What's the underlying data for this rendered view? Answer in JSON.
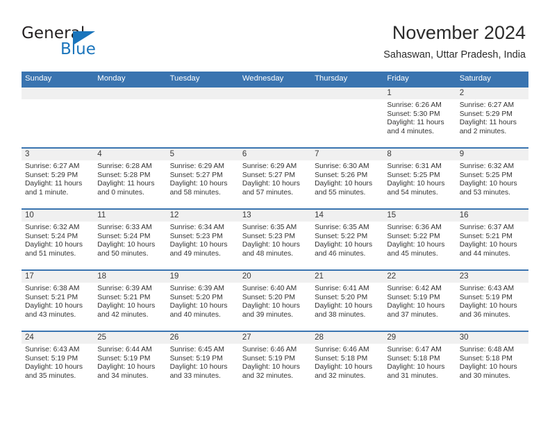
{
  "logo": {
    "word_one": "General",
    "word_two": "Blue",
    "triangle_icon": "triangle-icon",
    "accent_color": "#1b75bc"
  },
  "header": {
    "title": "November 2024",
    "subtitle": "Sahaswan, Uttar Pradesh, India"
  },
  "theme": {
    "header_blue": "#3a74b0",
    "band_gray": "#f0f0f0"
  },
  "calendar": {
    "day_names": [
      "Sunday",
      "Monday",
      "Tuesday",
      "Wednesday",
      "Thursday",
      "Friday",
      "Saturday"
    ],
    "weeks": [
      [
        {
          "day": ""
        },
        {
          "day": ""
        },
        {
          "day": ""
        },
        {
          "day": ""
        },
        {
          "day": ""
        },
        {
          "day": "1",
          "sunrise": "Sunrise: 6:26 AM",
          "sunset": "Sunset: 5:30 PM",
          "daylight": "Daylight: 11 hours and 4 minutes."
        },
        {
          "day": "2",
          "sunrise": "Sunrise: 6:27 AM",
          "sunset": "Sunset: 5:29 PM",
          "daylight": "Daylight: 11 hours and 2 minutes."
        }
      ],
      [
        {
          "day": "3",
          "sunrise": "Sunrise: 6:27 AM",
          "sunset": "Sunset: 5:29 PM",
          "daylight": "Daylight: 11 hours and 1 minute."
        },
        {
          "day": "4",
          "sunrise": "Sunrise: 6:28 AM",
          "sunset": "Sunset: 5:28 PM",
          "daylight": "Daylight: 11 hours and 0 minutes."
        },
        {
          "day": "5",
          "sunrise": "Sunrise: 6:29 AM",
          "sunset": "Sunset: 5:27 PM",
          "daylight": "Daylight: 10 hours and 58 minutes."
        },
        {
          "day": "6",
          "sunrise": "Sunrise: 6:29 AM",
          "sunset": "Sunset: 5:27 PM",
          "daylight": "Daylight: 10 hours and 57 minutes."
        },
        {
          "day": "7",
          "sunrise": "Sunrise: 6:30 AM",
          "sunset": "Sunset: 5:26 PM",
          "daylight": "Daylight: 10 hours and 55 minutes."
        },
        {
          "day": "8",
          "sunrise": "Sunrise: 6:31 AM",
          "sunset": "Sunset: 5:25 PM",
          "daylight": "Daylight: 10 hours and 54 minutes."
        },
        {
          "day": "9",
          "sunrise": "Sunrise: 6:32 AM",
          "sunset": "Sunset: 5:25 PM",
          "daylight": "Daylight: 10 hours and 53 minutes."
        }
      ],
      [
        {
          "day": "10",
          "sunrise": "Sunrise: 6:32 AM",
          "sunset": "Sunset: 5:24 PM",
          "daylight": "Daylight: 10 hours and 51 minutes."
        },
        {
          "day": "11",
          "sunrise": "Sunrise: 6:33 AM",
          "sunset": "Sunset: 5:24 PM",
          "daylight": "Daylight: 10 hours and 50 minutes."
        },
        {
          "day": "12",
          "sunrise": "Sunrise: 6:34 AM",
          "sunset": "Sunset: 5:23 PM",
          "daylight": "Daylight: 10 hours and 49 minutes."
        },
        {
          "day": "13",
          "sunrise": "Sunrise: 6:35 AM",
          "sunset": "Sunset: 5:23 PM",
          "daylight": "Daylight: 10 hours and 48 minutes."
        },
        {
          "day": "14",
          "sunrise": "Sunrise: 6:35 AM",
          "sunset": "Sunset: 5:22 PM",
          "daylight": "Daylight: 10 hours and 46 minutes."
        },
        {
          "day": "15",
          "sunrise": "Sunrise: 6:36 AM",
          "sunset": "Sunset: 5:22 PM",
          "daylight": "Daylight: 10 hours and 45 minutes."
        },
        {
          "day": "16",
          "sunrise": "Sunrise: 6:37 AM",
          "sunset": "Sunset: 5:21 PM",
          "daylight": "Daylight: 10 hours and 44 minutes."
        }
      ],
      [
        {
          "day": "17",
          "sunrise": "Sunrise: 6:38 AM",
          "sunset": "Sunset: 5:21 PM",
          "daylight": "Daylight: 10 hours and 43 minutes."
        },
        {
          "day": "18",
          "sunrise": "Sunrise: 6:39 AM",
          "sunset": "Sunset: 5:21 PM",
          "daylight": "Daylight: 10 hours and 42 minutes."
        },
        {
          "day": "19",
          "sunrise": "Sunrise: 6:39 AM",
          "sunset": "Sunset: 5:20 PM",
          "daylight": "Daylight: 10 hours and 40 minutes."
        },
        {
          "day": "20",
          "sunrise": "Sunrise: 6:40 AM",
          "sunset": "Sunset: 5:20 PM",
          "daylight": "Daylight: 10 hours and 39 minutes."
        },
        {
          "day": "21",
          "sunrise": "Sunrise: 6:41 AM",
          "sunset": "Sunset: 5:20 PM",
          "daylight": "Daylight: 10 hours and 38 minutes."
        },
        {
          "day": "22",
          "sunrise": "Sunrise: 6:42 AM",
          "sunset": "Sunset: 5:19 PM",
          "daylight": "Daylight: 10 hours and 37 minutes."
        },
        {
          "day": "23",
          "sunrise": "Sunrise: 6:43 AM",
          "sunset": "Sunset: 5:19 PM",
          "daylight": "Daylight: 10 hours and 36 minutes."
        }
      ],
      [
        {
          "day": "24",
          "sunrise": "Sunrise: 6:43 AM",
          "sunset": "Sunset: 5:19 PM",
          "daylight": "Daylight: 10 hours and 35 minutes."
        },
        {
          "day": "25",
          "sunrise": "Sunrise: 6:44 AM",
          "sunset": "Sunset: 5:19 PM",
          "daylight": "Daylight: 10 hours and 34 minutes."
        },
        {
          "day": "26",
          "sunrise": "Sunrise: 6:45 AM",
          "sunset": "Sunset: 5:19 PM",
          "daylight": "Daylight: 10 hours and 33 minutes."
        },
        {
          "day": "27",
          "sunrise": "Sunrise: 6:46 AM",
          "sunset": "Sunset: 5:19 PM",
          "daylight": "Daylight: 10 hours and 32 minutes."
        },
        {
          "day": "28",
          "sunrise": "Sunrise: 6:46 AM",
          "sunset": "Sunset: 5:18 PM",
          "daylight": "Daylight: 10 hours and 32 minutes."
        },
        {
          "day": "29",
          "sunrise": "Sunrise: 6:47 AM",
          "sunset": "Sunset: 5:18 PM",
          "daylight": "Daylight: 10 hours and 31 minutes."
        },
        {
          "day": "30",
          "sunrise": "Sunrise: 6:48 AM",
          "sunset": "Sunset: 5:18 PM",
          "daylight": "Daylight: 10 hours and 30 minutes."
        }
      ]
    ]
  }
}
